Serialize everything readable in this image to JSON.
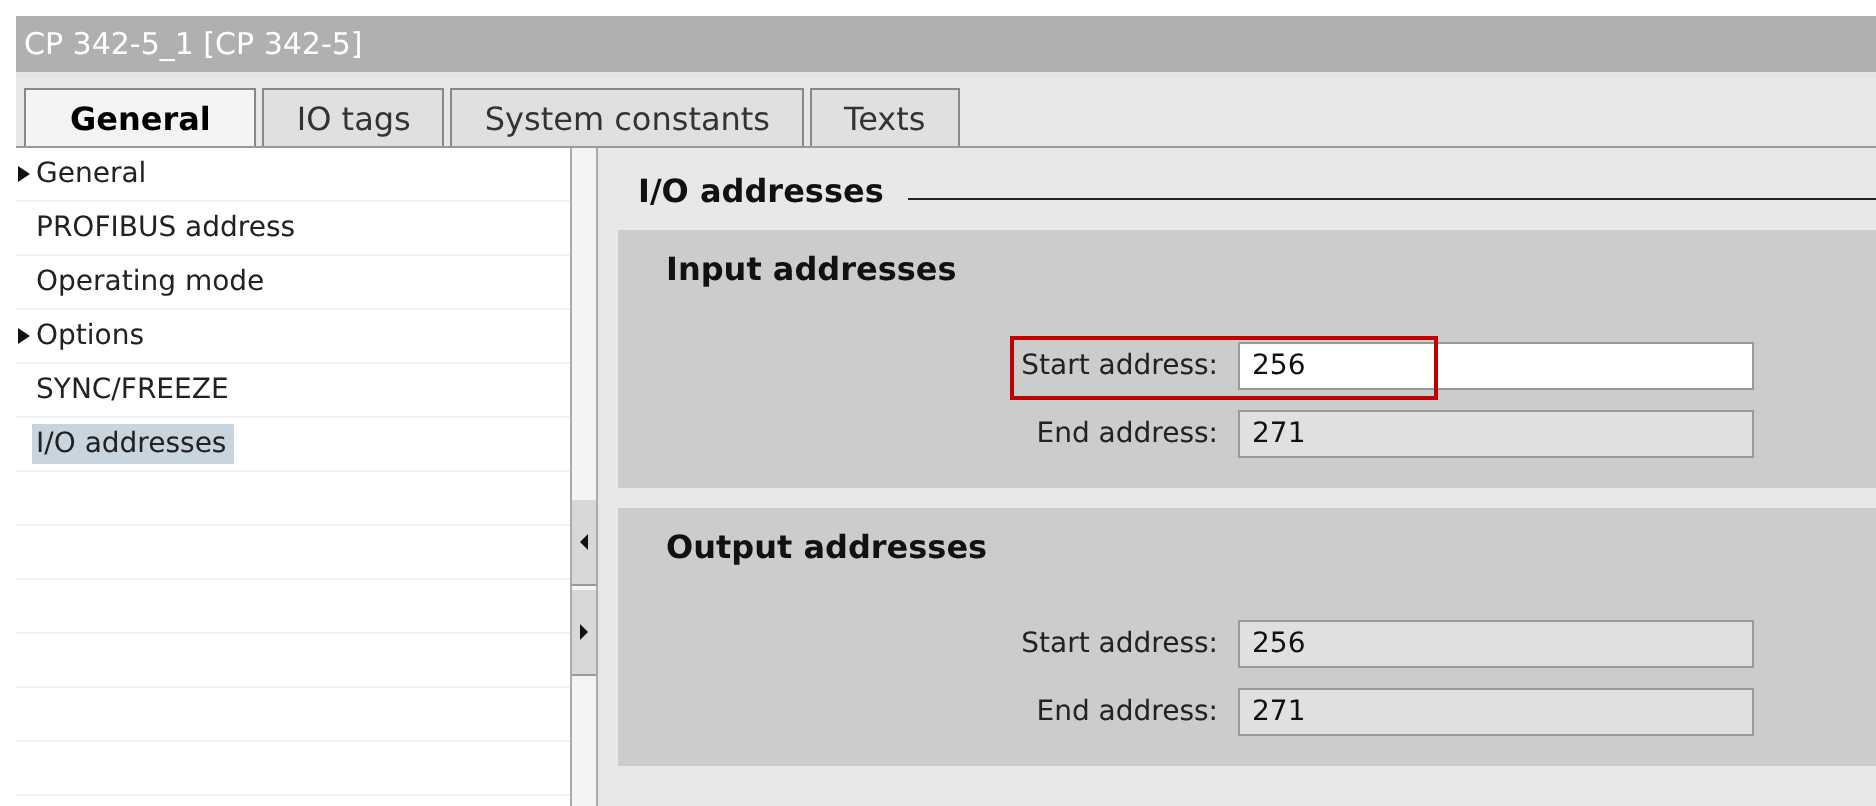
{
  "window": {
    "title": "CP 342-5_1 [CP 342-5]"
  },
  "tabs": [
    {
      "label": "General",
      "selected": true
    },
    {
      "label": "IO tags",
      "selected": false
    },
    {
      "label": "System constants",
      "selected": false
    },
    {
      "label": "Texts",
      "selected": false
    }
  ],
  "sidebar": {
    "items": [
      {
        "label": "General",
        "expandable": true,
        "selected": false
      },
      {
        "label": "PROFIBUS address",
        "expandable": false,
        "selected": false
      },
      {
        "label": "Operating mode",
        "expandable": false,
        "selected": false
      },
      {
        "label": "Options",
        "expandable": true,
        "selected": false
      },
      {
        "label": "SYNC/FREEZE",
        "expandable": false,
        "selected": false
      },
      {
        "label": "I/O addresses",
        "expandable": false,
        "selected": true
      }
    ]
  },
  "content": {
    "heading": "I/O addresses",
    "sections": [
      {
        "title": "Input addresses",
        "fields": [
          {
            "label": "Start address:",
            "value": "256",
            "editable": true,
            "highlighted": true
          },
          {
            "label": "End address:",
            "value": "271",
            "editable": false,
            "highlighted": false
          }
        ]
      },
      {
        "title": "Output addresses",
        "fields": [
          {
            "label": "Start address:",
            "value": "256",
            "editable": false,
            "highlighted": false
          },
          {
            "label": "End address:",
            "value": "271",
            "editable": false,
            "highlighted": false
          }
        ]
      }
    ]
  }
}
